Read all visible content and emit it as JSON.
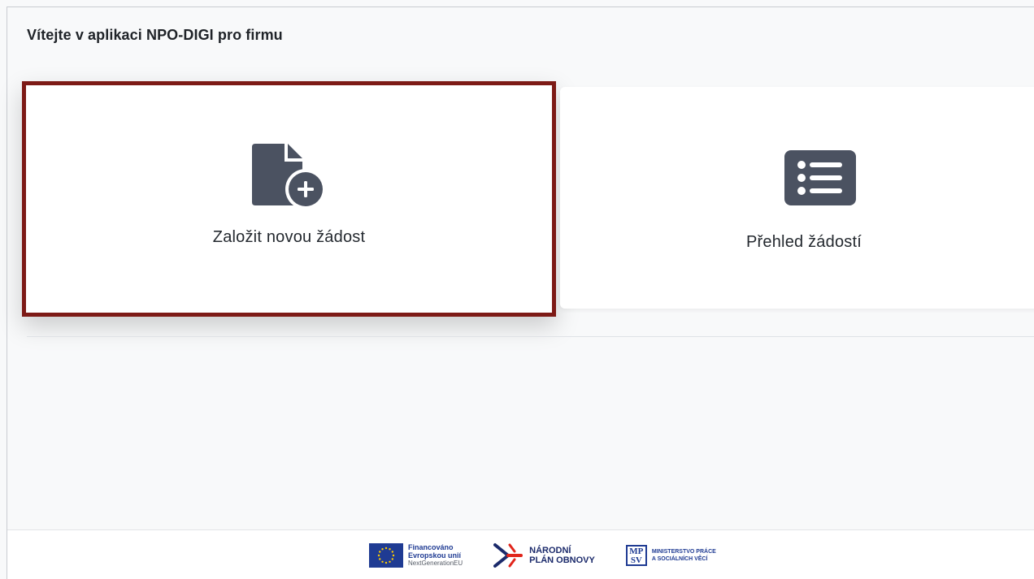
{
  "page": {
    "title": "Vítejte v aplikaci NPO-DIGI pro firmu"
  },
  "cards": [
    {
      "label": "Založit novou žádost",
      "icon": "file-plus-icon"
    },
    {
      "label": "Přehled žádostí",
      "icon": "list-icon"
    }
  ],
  "footer": {
    "eu": {
      "line1": "Financováno",
      "line2": "Evropskou unií",
      "line3": "NextGenerationEU"
    },
    "npo": {
      "line1": "NÁRODNÍ",
      "line2": "PLÁN OBNOVY"
    },
    "mpsv": {
      "abbr1": "MP",
      "abbr2": "SV",
      "line1": "MINISTERSTVO PRÁCE",
      "line2": "A SOCIÁLNÍCH VĚCÍ"
    }
  },
  "colors": {
    "icon": "#4b5261",
    "highlight_border": "#7d1a16",
    "eu_blue": "#1f3b93",
    "npo_red": "#e1251b"
  }
}
